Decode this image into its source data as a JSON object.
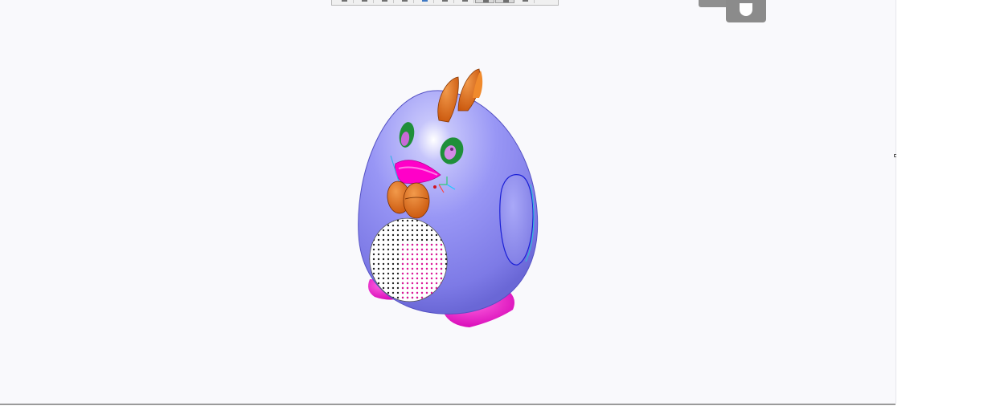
{
  "viewport": {
    "background": "#f9f9fc",
    "model": {
      "body_color": "#8f8cf2",
      "accent_color": "#ff00c8",
      "beak_color": "#e86b14",
      "eye_color": "#1f8f3a",
      "crest_color": "#e56a10"
    }
  },
  "hud_toolbar": {
    "buttons": [
      {
        "icon": "view-icon"
      },
      {
        "icon": "zoom-icon"
      },
      {
        "icon": "pan-icon"
      },
      {
        "icon": "rotate-icon"
      },
      {
        "icon": "display-style-icon"
      },
      {
        "icon": "section-icon"
      },
      {
        "icon": "hide-show-icon"
      },
      {
        "icon": "appearance-icon"
      },
      {
        "icon": "scene-icon"
      },
      {
        "icon": "view-setting-icon"
      }
    ]
  }
}
